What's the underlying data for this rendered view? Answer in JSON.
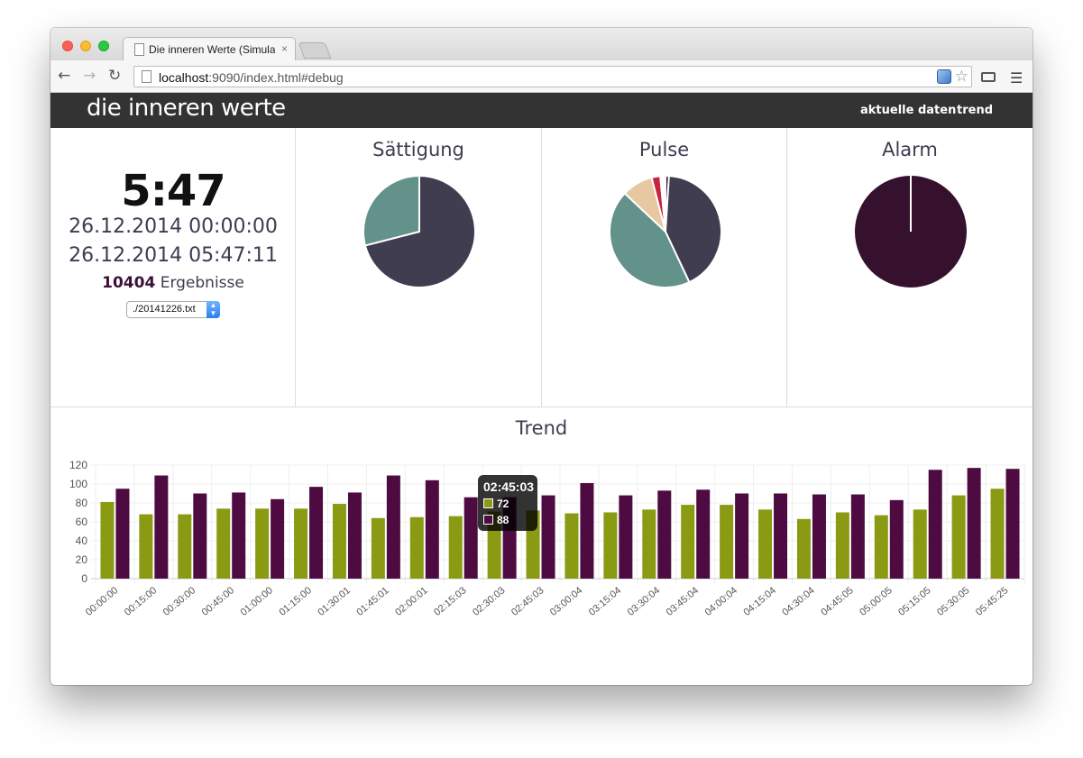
{
  "browser": {
    "tab_title": "Die inneren Werte (Simulati",
    "tab_close": "×",
    "url_host": "localhost",
    "url_rest": ":9090/index.html#debug"
  },
  "app": {
    "brand": "die inneren werte",
    "nav": {
      "current": "aktuelle daten",
      "trend": "trend"
    }
  },
  "summary": {
    "elapsed": "5:47",
    "start": "26.12.2014 00:00:00",
    "end": "26.12.2014 05:47:11",
    "result_count": "10404",
    "result_label": "Ergebnisse",
    "file_select_value": "./20141226.txt"
  },
  "colors": {
    "dark": "#403d50",
    "teal": "#63928a",
    "peach": "#e8c8a0",
    "red": "#c8233f",
    "plum": "#35112e",
    "olive": "#8b9a13",
    "purple": "#4d0b42"
  },
  "pies": [
    {
      "title": "Sättigung",
      "slices": [
        {
          "value": 71,
          "color": "#403d50"
        },
        {
          "value": 29,
          "color": "#63928a"
        }
      ]
    },
    {
      "title": "Pulse",
      "slices": [
        {
          "value": 1,
          "color": "#35112e"
        },
        {
          "value": 42,
          "color": "#403d50"
        },
        {
          "value": 44,
          "color": "#63928a"
        },
        {
          "value": 9,
          "color": "#e8c8a0"
        },
        {
          "value": 2.5,
          "color": "#c8233f"
        },
        {
          "value": 1.5,
          "color": "#ffffff"
        }
      ]
    },
    {
      "title": "Alarm",
      "slices": [
        {
          "value": 100,
          "color": "#35112e"
        }
      ]
    }
  ],
  "trend": {
    "title": "Trend",
    "tooltip": {
      "label": "02:45:03",
      "values": [
        "72",
        "88"
      ]
    },
    "chart_data": {
      "type": "bar",
      "categories": [
        "00:00:00",
        "00:15:00",
        "00:30:00",
        "00:45:00",
        "01:00:00",
        "01:15:00",
        "01:30:01",
        "01:45:01",
        "02:00:01",
        "02:15:03",
        "02:30:03",
        "02:45:03",
        "03:00:04",
        "03:15:04",
        "03:30:04",
        "03:45:04",
        "04:00:04",
        "04:15:04",
        "04:30:04",
        "04:45:05",
        "05:00:05",
        "05:15:05",
        "05:30:05",
        "05:45:25"
      ],
      "series": [
        {
          "color": "#8b9a13",
          "values": [
            81,
            68,
            68,
            74,
            74,
            74,
            79,
            64,
            65,
            66,
            71,
            72,
            69,
            70,
            73,
            78,
            78,
            73,
            63,
            70,
            67,
            73,
            88,
            95
          ]
        },
        {
          "color": "#4d0b42",
          "values": [
            95,
            109,
            90,
            91,
            84,
            97,
            91,
            109,
            104,
            86,
            86,
            88,
            101,
            88,
            93,
            94,
            90,
            90,
            89,
            89,
            83,
            115,
            117,
            116
          ]
        }
      ],
      "ylim": [
        0,
        120
      ],
      "yticks": [
        0,
        20,
        40,
        60,
        80,
        100,
        120
      ],
      "grid": true,
      "legend": false
    }
  }
}
